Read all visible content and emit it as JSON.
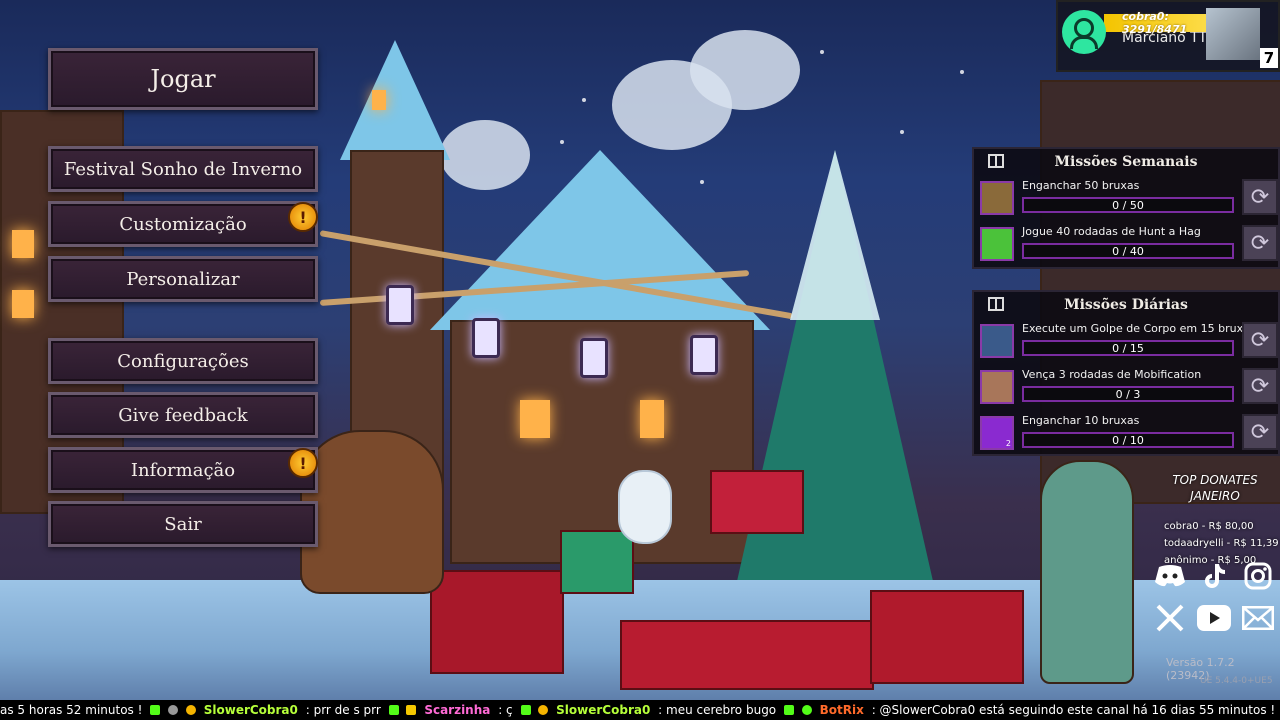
{
  "menu": {
    "play": "Jogar",
    "festival": "Festival Sonho de Inverno",
    "customization": "Customização",
    "personalize": "Personalizar",
    "settings": "Configurações",
    "feedback": "Give feedback",
    "info": "Informação",
    "quit": "Sair",
    "alert_glyph": "!"
  },
  "user_card": {
    "donation_text": "cobra0: 3291/8471",
    "streamer_name": "Marciano TTV",
    "badge_count": "7"
  },
  "weekly": {
    "title": "Missões Semanais",
    "missions": [
      {
        "label": "Enganchar 50 bruxas",
        "progress": "0 / 50",
        "icon": "broom-icon"
      },
      {
        "label": "Jogue 40 rodadas de Hunt a Hag",
        "progress": "0 / 40",
        "icon": "hag-skull-icon"
      }
    ]
  },
  "daily": {
    "title": "Missões Diárias",
    "missions": [
      {
        "label": "Execute um Golpe de Corpo em 15 bruxas",
        "progress": "0 / 15",
        "icon": "armor-icon"
      },
      {
        "label": "Vença 3 rodadas de Mobification",
        "progress": "0 / 3",
        "icon": "face-icon"
      },
      {
        "label": "Enganchar 10 bruxas",
        "progress": "0 / 10",
        "icon": "magic-crystal-icon",
        "badge": "2"
      }
    ]
  },
  "donors": {
    "title_line1": "TOP DONATES",
    "title_line2": "JANEIRO",
    "list": [
      "cobra0 - R$ 80,00",
      "todaadryelli - R$ 11,39",
      "anônimo - R$ 5,00"
    ]
  },
  "socials": [
    "discord-icon",
    "tiktok-icon",
    "instagram-icon",
    "x-icon",
    "youtube-icon",
    "mail-icon"
  ],
  "version": {
    "line1": "Versão 1.7.2 (23942)",
    "line2": "UE 5.4.4-0+UE5"
  },
  "ticker": {
    "seg1": "as 5 horas 52 minutos !",
    "user1": "SlowerCobra0",
    "msg1": ": prr de s prr",
    "user2": "Scarzinha",
    "msg2": ": ç",
    "user3": "SlowerCobra0",
    "msg3": ": meu cerebro bugo",
    "user4": "BotRix",
    "msg4": ": @SlowerCobra0 está seguindo este canal há 16 dias 55 minutos !"
  },
  "colors": {
    "menu_bg": "#2a1a2c",
    "menu_border": "#6a5a6e",
    "mission_bar_border": "#7a2ca0",
    "alert": "#f5b400",
    "ticker_green": "#b6ff3a",
    "ticker_pink": "#ff6ad5"
  }
}
